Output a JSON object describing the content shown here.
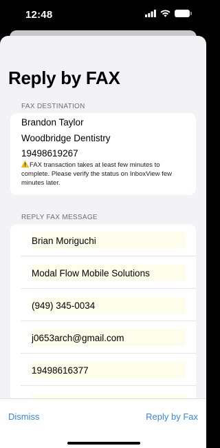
{
  "status_bar": {
    "time": "12:48"
  },
  "sheet": {
    "title": "Reply by FAX",
    "destination": {
      "header": "FAX DESTINATION",
      "name": "Brandon Taylor",
      "company": "Woodbridge Dentistry",
      "fax_number": "19498619267",
      "note": "FAX transaction takes at least few minutes to complete. Please verify the status on InboxView few minutes later."
    },
    "message": {
      "header": "REPLY FAX MESSAGE",
      "fields": [
        "Brian Moriguchi",
        "Modal Flow Mobile Solutions",
        "(949) 345-0034",
        "j0653arch@gmail.com",
        "19498616377",
        ""
      ]
    }
  },
  "bottom_bar": {
    "dismiss_label": "Dismiss",
    "reply_label": "Reply by Fax",
    "accent_color": "#3a86d8"
  },
  "icons": {
    "warning": "warning-icon",
    "signal": "cellular-signal-icon",
    "wifi": "wifi-icon",
    "battery": "battery-icon"
  }
}
